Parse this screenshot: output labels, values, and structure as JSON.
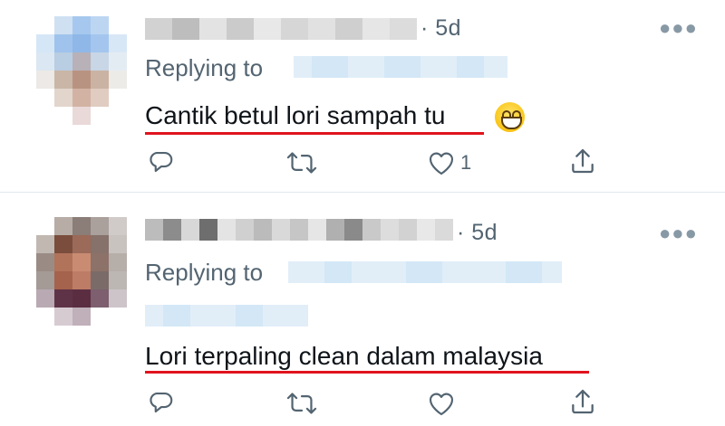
{
  "tweets": [
    {
      "time": "· 5d",
      "replying_label": "Replying to",
      "text": "Cantik betul lori sampah tu",
      "emoji": "grinning-face-with-smiling-eyes",
      "like_count": "1"
    },
    {
      "time": "· 5d",
      "replying_label": "Replying to",
      "text": "Lori terpaling clean dalam malaysia",
      "like_count": ""
    }
  ],
  "colors": {
    "secondary_text": "#536471",
    "underline_annotation": "#e0141e",
    "divider": "#e1e8ed"
  },
  "icons": [
    "reply-icon",
    "retweet-icon",
    "like-icon",
    "share-icon",
    "more-options-icon"
  ]
}
